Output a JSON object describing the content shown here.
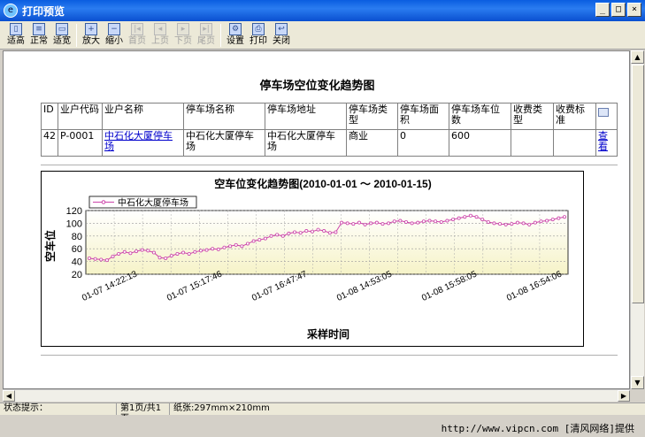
{
  "window": {
    "title": "打印预览",
    "controls": [
      "_",
      "□",
      "×"
    ]
  },
  "toolbar": {
    "items": [
      {
        "label": "适高",
        "icon": "fit-height-icon",
        "enabled": true
      },
      {
        "label": "正常",
        "icon": "normal-size-icon",
        "enabled": true
      },
      {
        "label": "适宽",
        "icon": "fit-width-icon",
        "enabled": true
      },
      {
        "label": "放大",
        "icon": "zoom-in-icon",
        "enabled": true
      },
      {
        "label": "缩小",
        "icon": "zoom-out-icon",
        "enabled": true
      },
      {
        "label": "首页",
        "icon": "first-page-icon",
        "enabled": false
      },
      {
        "label": "上页",
        "icon": "prev-page-icon",
        "enabled": false
      },
      {
        "label": "下页",
        "icon": "next-page-icon",
        "enabled": false
      },
      {
        "label": "尾页",
        "icon": "last-page-icon",
        "enabled": false
      },
      {
        "label": "设置",
        "icon": "settings-icon",
        "enabled": true
      },
      {
        "label": "打印",
        "icon": "printer-icon",
        "enabled": true
      },
      {
        "label": "关闭",
        "icon": "close-icon",
        "enabled": true
      }
    ]
  },
  "report": {
    "title": "停车场空位变化趋势图",
    "table": {
      "headers": [
        "ID",
        "业户代码",
        "业户名称",
        "停车场名称",
        "停车场地址",
        "停车场类型",
        "停车场面积",
        "停车场车位数",
        "收费类型",
        "收费标准",
        ""
      ],
      "rows": [
        [
          "42",
          "P-0001",
          "中石化大厦停车场",
          "中石化大厦停车场",
          "中石化大厦停车场",
          "商业",
          "0",
          "600",
          "",
          "",
          "查看"
        ]
      ]
    }
  },
  "chart_data": {
    "type": "line",
    "title": "空车位变化趋势图(2010-01-01 ～ 2010-01-15)",
    "xlabel": "采样时间",
    "ylabel": "空车位",
    "ylim": [
      20,
      120
    ],
    "yticks": [
      20,
      40,
      60,
      80,
      100,
      120
    ],
    "xtick_labels": [
      "01-07 14:22:13",
      "01-07 15:17:46",
      "01-07 16:47:47",
      "01-08 14:53:05",
      "01-08 15:58:05",
      "01-08 16:54:06"
    ],
    "legend_position": "top-left",
    "grid": true,
    "series": [
      {
        "name": "中石化大厦停车场",
        "color": "#cc44aa",
        "values": [
          45,
          44,
          43,
          42,
          48,
          52,
          55,
          53,
          56,
          58,
          57,
          54,
          46,
          45,
          49,
          52,
          54,
          52,
          55,
          57,
          58,
          60,
          59,
          62,
          64,
          66,
          64,
          68,
          72,
          74,
          76,
          80,
          82,
          80,
          84,
          86,
          85,
          88,
          87,
          90,
          88,
          85,
          86,
          101,
          100,
          99,
          101,
          98,
          100,
          101,
          99,
          100,
          103,
          104,
          102,
          100,
          101,
          103,
          104,
          103,
          102,
          104,
          106,
          108,
          110,
          112,
          110,
          106,
          102,
          100,
          99,
          98,
          99,
          101,
          100,
          98,
          101,
          103,
          104,
          106,
          108,
          110
        ]
      }
    ]
  },
  "status": {
    "hint_label": "状态提示：",
    "page": "第1页/共1页",
    "paper": "纸张:297mm×210mm"
  },
  "footer": {
    "credit": "http://www.vipcn.com [清风网络]提供"
  }
}
